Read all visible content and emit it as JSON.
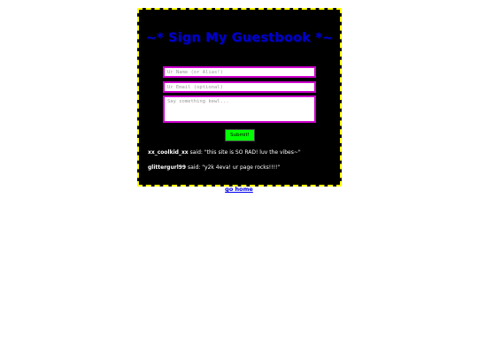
{
  "guestbook": {
    "title": "~* Sign My Guestbook *~",
    "name_placeholder": "Ur Name (or Alias!)",
    "email_placeholder": "Ur Email (optional)",
    "message_placeholder": "Say something kewl...",
    "submit_label": "Submit!",
    "entries": [
      {
        "author": "xx_coolkid_xx",
        "said": "said:",
        "message": "\"this site is SO RAD! luv the vibes~\""
      },
      {
        "author": "glittergurl99",
        "said": "said:",
        "message": "\"y2k 4eva! ur page rocks!!!!\""
      }
    ]
  },
  "footer": {
    "home_link": "go home"
  },
  "colors": {
    "panel_bg": "#000000",
    "border": "#ffff00",
    "title": "#0000cc",
    "field_border": "#cc00cc",
    "submit_bg": "#00ff00",
    "link": "#0000ee"
  }
}
